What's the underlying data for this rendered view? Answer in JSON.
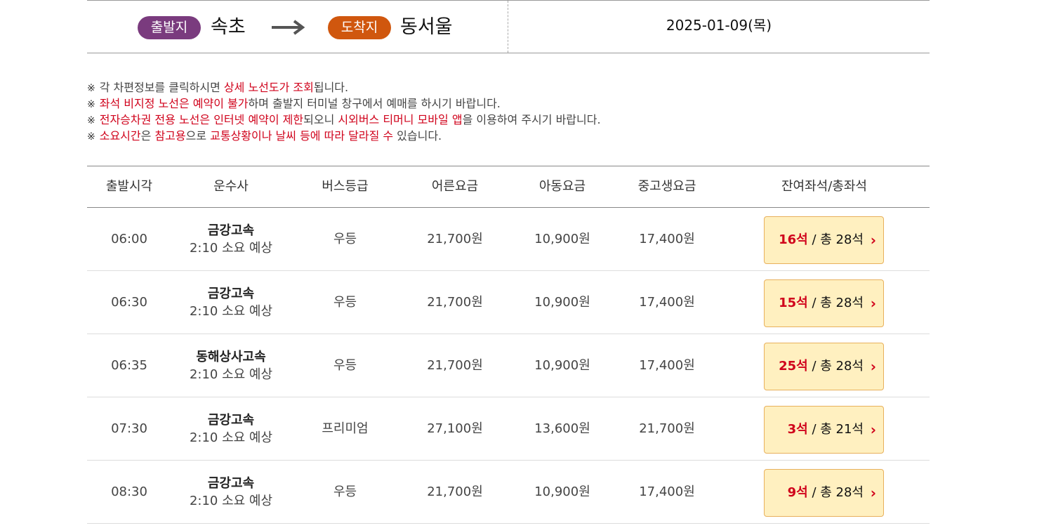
{
  "route": {
    "departure_label": "출발지",
    "departure_city": "속초",
    "arrival_label": "도착지",
    "arrival_city": "동서울",
    "date": "2025-01-09(목)",
    "colors": {
      "departure_pill": "#7a3b7e",
      "arrival_pill": "#d0570e"
    }
  },
  "notices": [
    {
      "segments": [
        {
          "t": "각 차편정보를 클릭하시면 ",
          "red": false
        },
        {
          "t": "상세 노선도가 조회",
          "red": true
        },
        {
          "t": "됩니다.",
          "red": false
        }
      ]
    },
    {
      "segments": [
        {
          "t": "좌석 비지정 노선은 예약이 불가",
          "red": true
        },
        {
          "t": "하며 출발지 터미널 창구에서 예매를 하시기 바랍니다.",
          "red": false
        }
      ]
    },
    {
      "segments": [
        {
          "t": "전자승차권 전용 노선은 인터넷 예약이 제한",
          "red": true
        },
        {
          "t": "되오니 ",
          "red": false
        },
        {
          "t": "시외버스 티머니 모바일 앱",
          "red": true
        },
        {
          "t": "을 이용하여 주시기 바랍니다.",
          "red": false
        }
      ]
    },
    {
      "segments": [
        {
          "t": "소요시간",
          "red": true
        },
        {
          "t": "은 ",
          "red": false
        },
        {
          "t": "참고용",
          "red": true
        },
        {
          "t": "으로 ",
          "red": false
        },
        {
          "t": "교통상황이나 날씨 등에 따라 달라질 수",
          "red": true
        },
        {
          "t": " 있습니다.",
          "red": false
        }
      ]
    }
  ],
  "notice_marker": "※",
  "table": {
    "headers": [
      "출발시각",
      "운수사",
      "버스등급",
      "어른요금",
      "아동요금",
      "중고생요금",
      "잔여좌석/총좌석"
    ],
    "rows": [
      {
        "time": "06:00",
        "company": "금강고속",
        "duration": "2:10 소요 예상",
        "grade": "우등",
        "adult": "21,700원",
        "child": "10,900원",
        "student": "17,400원",
        "seats_left": "16석",
        "seats_total": " / 총 28석"
      },
      {
        "time": "06:30",
        "company": "금강고속",
        "duration": "2:10 소요 예상",
        "grade": "우등",
        "adult": "21,700원",
        "child": "10,900원",
        "student": "17,400원",
        "seats_left": "15석",
        "seats_total": " / 총 28석"
      },
      {
        "time": "06:35",
        "company": "동해상사고속",
        "duration": "2:10 소요 예상",
        "grade": "우등",
        "adult": "21,700원",
        "child": "10,900원",
        "student": "17,400원",
        "seats_left": "25석",
        "seats_total": " / 총 28석"
      },
      {
        "time": "07:30",
        "company": "금강고속",
        "duration": "2:10 소요 예상",
        "grade": "프리미엄",
        "adult": "27,100원",
        "child": "13,600원",
        "student": "21,700원",
        "seats_left": "3석",
        "seats_total": " / 총 21석"
      },
      {
        "time": "08:30",
        "company": "금강고속",
        "duration": "2:10 소요 예상",
        "grade": "우등",
        "adult": "21,700원",
        "child": "10,900원",
        "student": "17,400원",
        "seats_left": "9석",
        "seats_total": " / 총 28석"
      }
    ]
  },
  "icons": {
    "route_arrow": "arrow-right-icon",
    "seat_chevron": "chevron-right-icon"
  }
}
